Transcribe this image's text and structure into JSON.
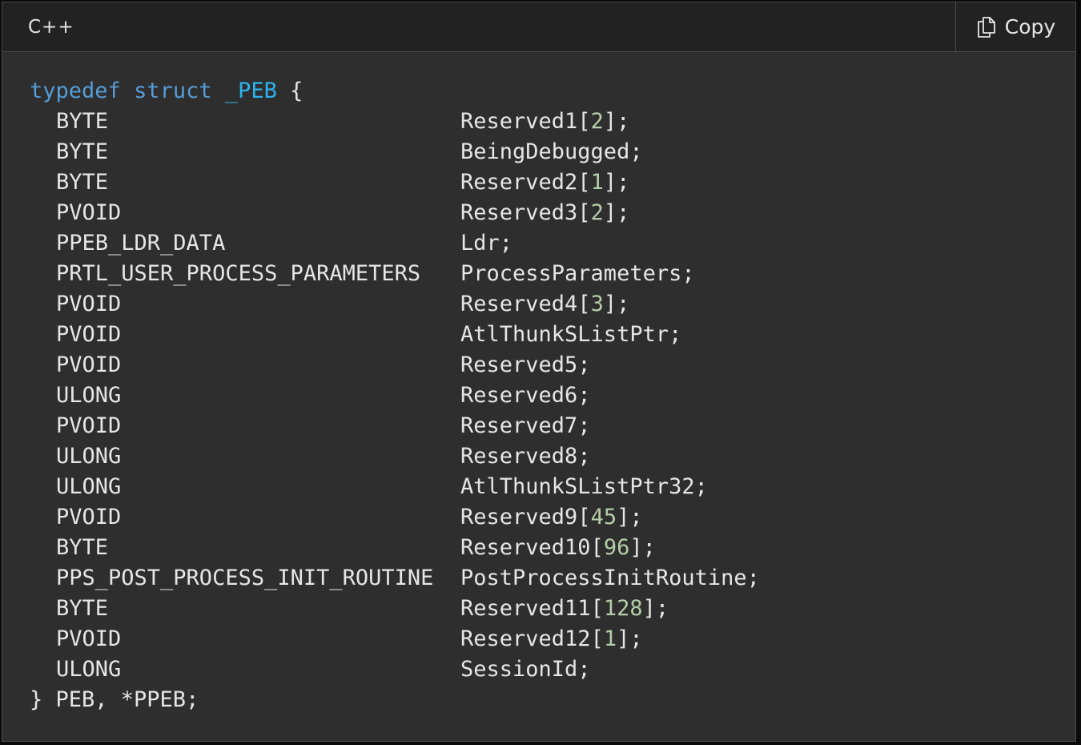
{
  "header": {
    "language": "C++",
    "copy_label": "Copy",
    "copy_icon": "copy-icon"
  },
  "code": {
    "open": {
      "kw1": "typedef",
      "kw2": "struct",
      "name": "_PEB",
      "brace": "{"
    },
    "members": [
      {
        "type": "BYTE",
        "name": "Reserved1",
        "index": "2"
      },
      {
        "type": "BYTE",
        "name": "BeingDebugged",
        "index": null
      },
      {
        "type": "BYTE",
        "name": "Reserved2",
        "index": "1"
      },
      {
        "type": "PVOID",
        "name": "Reserved3",
        "index": "2"
      },
      {
        "type": "PPEB_LDR_DATA",
        "name": "Ldr",
        "index": null
      },
      {
        "type": "PRTL_USER_PROCESS_PARAMETERS",
        "name": "ProcessParameters",
        "index": null
      },
      {
        "type": "PVOID",
        "name": "Reserved4",
        "index": "3"
      },
      {
        "type": "PVOID",
        "name": "AtlThunkSListPtr",
        "index": null
      },
      {
        "type": "PVOID",
        "name": "Reserved5",
        "index": null
      },
      {
        "type": "ULONG",
        "name": "Reserved6",
        "index": null
      },
      {
        "type": "PVOID",
        "name": "Reserved7",
        "index": null
      },
      {
        "type": "ULONG",
        "name": "Reserved8",
        "index": null
      },
      {
        "type": "ULONG",
        "name": "AtlThunkSListPtr32",
        "index": null
      },
      {
        "type": "PVOID",
        "name": "Reserved9",
        "index": "45"
      },
      {
        "type": "BYTE",
        "name": "Reserved10",
        "index": "96"
      },
      {
        "type": "PPS_POST_PROCESS_INIT_ROUTINE",
        "name": "PostProcessInitRoutine",
        "index": null
      },
      {
        "type": "BYTE",
        "name": "Reserved11",
        "index": "128"
      },
      {
        "type": "PVOID",
        "name": "Reserved12",
        "index": "1"
      },
      {
        "type": "ULONG",
        "name": "SessionId",
        "index": null
      }
    ],
    "close": "} PEB, *PPEB;"
  },
  "colors": {
    "keyword": "#569cd6",
    "type_name": "#2bb5f0",
    "number": "#b5cea8",
    "text": "#e6e6e6",
    "background": "#2e2e2e",
    "header_background": "#222222"
  }
}
